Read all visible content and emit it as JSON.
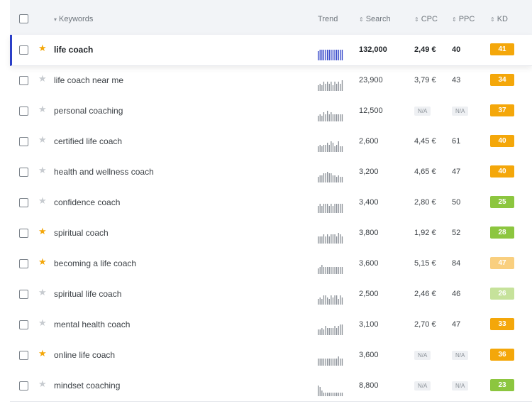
{
  "header": {
    "keywords_label": "Keywords",
    "trend_label": "Trend",
    "search_label": "Search",
    "cpc_label": "CPC",
    "ppc_label": "PPC",
    "kd_label": "KD"
  },
  "rows": [
    {
      "keyword": "life coach",
      "starred": true,
      "active": true,
      "search": "132,000",
      "cpc": "2,49 €",
      "ppc": "40",
      "kd": "41",
      "kd_color": "#f4a70a",
      "trend": [
        5,
        6,
        6,
        6,
        6,
        6,
        6,
        6,
        6,
        6,
        6,
        6,
        6,
        6
      ]
    },
    {
      "keyword": "life coach near me",
      "starred": false,
      "active": false,
      "search": "23,900",
      "cpc": "3,79 €",
      "ppc": "43",
      "kd": "34",
      "kd_color": "#f4a70a",
      "trend": [
        3,
        4,
        3,
        5,
        4,
        5,
        4,
        5,
        3,
        5,
        4,
        5,
        4,
        6
      ]
    },
    {
      "keyword": "personal coaching",
      "starred": false,
      "active": false,
      "search": "12,500",
      "cpc": "N/A",
      "ppc": "N/A",
      "kd": "37",
      "kd_color": "#f4a70a",
      "trend": [
        3,
        4,
        3,
        5,
        4,
        6,
        4,
        5,
        4,
        4,
        4,
        4,
        4,
        4
      ]
    },
    {
      "keyword": "certified life coach",
      "starred": false,
      "active": false,
      "search": "2,600",
      "cpc": "4,45 €",
      "ppc": "61",
      "kd": "40",
      "kd_color": "#f4a70a",
      "trend": [
        3,
        4,
        3,
        4,
        4,
        5,
        4,
        6,
        5,
        3,
        4,
        6,
        3,
        3
      ]
    },
    {
      "keyword": "health and wellness coach",
      "starred": false,
      "active": false,
      "search": "3,200",
      "cpc": "4,65 €",
      "ppc": "47",
      "kd": "40",
      "kd_color": "#f4a70a",
      "trend": [
        3,
        4,
        4,
        5,
        5,
        6,
        5,
        5,
        4,
        4,
        3,
        4,
        3,
        3
      ]
    },
    {
      "keyword": "confidence coach",
      "starred": false,
      "active": false,
      "search": "3,400",
      "cpc": "2,80 €",
      "ppc": "50",
      "kd": "25",
      "kd_color": "#8cc63f",
      "trend": [
        4,
        5,
        4,
        5,
        5,
        5,
        4,
        5,
        4,
        5,
        5,
        5,
        5,
        5
      ]
    },
    {
      "keyword": "spiritual coach",
      "starred": true,
      "active": false,
      "search": "3,800",
      "cpc": "1,92 €",
      "ppc": "52",
      "kd": "28",
      "kd_color": "#8cc63f",
      "trend": [
        4,
        4,
        4,
        5,
        4,
        5,
        4,
        5,
        5,
        5,
        4,
        6,
        5,
        4
      ]
    },
    {
      "keyword": "becoming a life coach",
      "starred": true,
      "active": false,
      "search": "3,600",
      "cpc": "5,15 €",
      "ppc": "84",
      "kd": "47",
      "kd_color": "#f9cf7f",
      "trend": [
        3,
        4,
        5,
        4,
        4,
        4,
        4,
        4,
        4,
        4,
        4,
        4,
        4,
        4
      ]
    },
    {
      "keyword": "spiritual life coach",
      "starred": false,
      "active": false,
      "search": "2,500",
      "cpc": "2,46 €",
      "ppc": "46",
      "kd": "26",
      "kd_color": "#c6e29b",
      "trend": [
        3,
        4,
        3,
        5,
        5,
        4,
        3,
        5,
        4,
        5,
        5,
        3,
        5,
        4
      ]
    },
    {
      "keyword": "mental health coach",
      "starred": false,
      "active": false,
      "search": "3,100",
      "cpc": "2,70 €",
      "ppc": "47",
      "kd": "33",
      "kd_color": "#f4a70a",
      "trend": [
        3,
        3,
        4,
        3,
        5,
        4,
        4,
        4,
        4,
        5,
        4,
        5,
        6,
        6
      ]
    },
    {
      "keyword": "online life coach",
      "starred": true,
      "active": false,
      "search": "3,600",
      "cpc": "N/A",
      "ppc": "N/A",
      "kd": "36",
      "kd_color": "#f4a70a",
      "trend": [
        4,
        4,
        4,
        4,
        4,
        4,
        4,
        4,
        4,
        4,
        4,
        5,
        4,
        4
      ]
    },
    {
      "keyword": "mindset coaching",
      "starred": false,
      "active": false,
      "search": "8,800",
      "cpc": "N/A",
      "ppc": "N/A",
      "kd": "23",
      "kd_color": "#8cc63f",
      "trend": [
        6,
        5,
        3,
        2,
        2,
        2,
        2,
        2,
        2,
        2,
        2,
        2,
        2,
        2
      ]
    }
  ]
}
